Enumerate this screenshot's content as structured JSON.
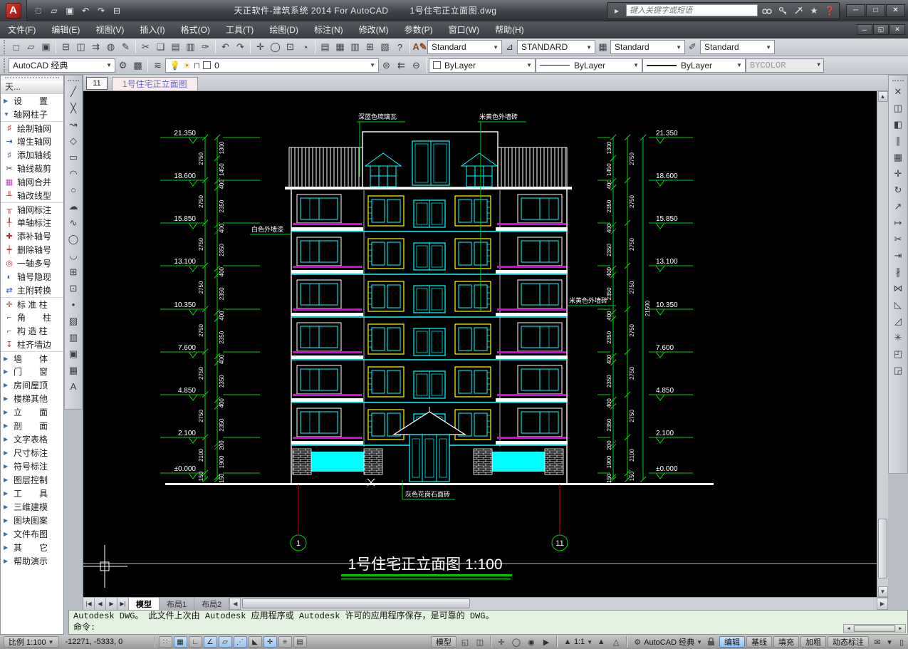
{
  "titlebar": {
    "app_title": "天正软件-建筑系统 2014  For AutoCAD",
    "doc_title": "1号住宅正立面图.dwg",
    "search_placeholder": "键入关键字或短语"
  },
  "icons": {
    "star": "★",
    "help": "?",
    "gear": "⚙",
    "caret": "▾",
    "min": "─",
    "max": "□",
    "close": "✕",
    "restore": "◱"
  },
  "menus": [
    "文件(F)",
    "编辑(E)",
    "视图(V)",
    "插入(I)",
    "格式(O)",
    "工具(T)",
    "绘图(D)",
    "标注(N)",
    "修改(M)",
    "参数(P)",
    "窗口(W)",
    "帮助(H)"
  ],
  "qat_tools": [
    {
      "name": "new",
      "glyph": "□"
    },
    {
      "name": "open",
      "glyph": "▱"
    },
    {
      "name": "save",
      "glyph": "▣"
    },
    {
      "name": "undo",
      "glyph": "↶"
    },
    {
      "name": "redo",
      "glyph": "↷"
    },
    {
      "name": "plot",
      "glyph": "⊟"
    }
  ],
  "toolbar1_tools": [
    {
      "name": "new",
      "glyph": "□"
    },
    {
      "name": "open",
      "glyph": "▱"
    },
    {
      "name": "save",
      "glyph": "▣"
    },
    {
      "name": "print",
      "glyph": "⊟"
    },
    {
      "name": "plot-preview",
      "glyph": "◫"
    },
    {
      "name": "publish",
      "glyph": "⇉"
    },
    {
      "name": "web",
      "glyph": "◍"
    },
    {
      "name": "markup",
      "glyph": "✎"
    },
    {
      "name": "cut",
      "glyph": "✂"
    },
    {
      "name": "copy-clip",
      "glyph": "❏"
    },
    {
      "name": "paste",
      "glyph": "▤"
    },
    {
      "name": "paste-block",
      "glyph": "▥"
    },
    {
      "name": "match-properties",
      "glyph": "✑"
    },
    {
      "name": "undo",
      "glyph": "↶"
    },
    {
      "name": "redo",
      "glyph": "↷"
    },
    {
      "name": "pan",
      "glyph": "✛"
    },
    {
      "name": "zoom-realtime",
      "glyph": "◯"
    },
    {
      "name": "zoom-window",
      "glyph": "⊡"
    },
    {
      "name": "zoom-previous",
      "glyph": "◔"
    },
    {
      "name": "properties",
      "glyph": "▤"
    },
    {
      "name": "designcenter",
      "glyph": "▦"
    },
    {
      "name": "tool-palettes",
      "glyph": "▥"
    },
    {
      "name": "sheet-set",
      "glyph": "⊞"
    },
    {
      "name": "calculator",
      "glyph": "▧"
    },
    {
      "name": "help",
      "glyph": "?"
    }
  ],
  "toolbar": {
    "text_style": "Standard",
    "dim_style": "STANDARD",
    "table_style": "Standard",
    "mleader_style": "Standard",
    "workspace": "AutoCAD 经典",
    "layer_value": "0",
    "color": "ByLayer",
    "linetype": "ByLayer",
    "lineweight": "ByLayer",
    "plot_style": "BYCOLOR"
  },
  "palette": {
    "title": "天...",
    "items": [
      {
        "t": "group",
        "label": "设　　置",
        "arrow": "▶"
      },
      {
        "t": "group",
        "label": "轴网柱子",
        "arrow": "▼"
      },
      {
        "t": "cmd",
        "label": "绘制轴网",
        "icon": "♯",
        "c": "#c03030",
        "sep": true
      },
      {
        "t": "cmd",
        "label": "增生轴网",
        "icon": "⇥",
        "c": "#3355bb"
      },
      {
        "t": "cmd",
        "label": "添加轴线",
        "icon": "♯",
        "c": "#667788"
      },
      {
        "t": "cmd",
        "label": "轴线裁剪",
        "icon": "✂",
        "c": "#333333"
      },
      {
        "t": "cmd",
        "label": "轴网合并",
        "icon": "▦",
        "c": "#bb44bb"
      },
      {
        "t": "cmd",
        "label": "轴改线型",
        "icon": "╨",
        "c": "#c03030"
      },
      {
        "t": "cmd",
        "label": "轴网标注",
        "icon": "╥",
        "c": "#c03030",
        "sep": true
      },
      {
        "t": "cmd",
        "label": "单轴标注",
        "icon": "╀",
        "c": "#c03030"
      },
      {
        "t": "cmd",
        "label": "添补轴号",
        "icon": "✚",
        "c": "#c03030"
      },
      {
        "t": "cmd",
        "label": "删除轴号",
        "icon": "┿",
        "c": "#c03030"
      },
      {
        "t": "cmd",
        "label": "一轴多号",
        "icon": "◎",
        "c": "#c03030"
      },
      {
        "t": "cmd",
        "label": "轴号隐现",
        "icon": "◐",
        "c": "#3355bb"
      },
      {
        "t": "cmd",
        "label": "主附转换",
        "icon": "⇄",
        "c": "#3355bb"
      },
      {
        "t": "cmd",
        "label": "标 准 柱",
        "icon": "✛",
        "c": "#c03030",
        "sep": true
      },
      {
        "t": "cmd",
        "label": "角　　柱",
        "icon": "⌐",
        "c": "#3355bb"
      },
      {
        "t": "cmd",
        "label": "构 造 柱",
        "icon": "⌐",
        "c": "#555555"
      },
      {
        "t": "cmd",
        "label": "柱齐墙边",
        "icon": "↧",
        "c": "#c03030"
      },
      {
        "t": "group",
        "label": "墙　　体",
        "arrow": "▶",
        "sep": true
      },
      {
        "t": "group",
        "label": "门　　窗",
        "arrow": "▶"
      },
      {
        "t": "group",
        "label": "房间屋顶",
        "arrow": "▶"
      },
      {
        "t": "group",
        "label": "楼梯其他",
        "arrow": "▶"
      },
      {
        "t": "group",
        "label": "立　　面",
        "arrow": "▶"
      },
      {
        "t": "group",
        "label": "剖　　面",
        "arrow": "▶"
      },
      {
        "t": "group",
        "label": "文字表格",
        "arrow": "▶"
      },
      {
        "t": "group",
        "label": "尺寸标注",
        "arrow": "▶"
      },
      {
        "t": "group",
        "label": "符号标注",
        "arrow": "▶"
      },
      {
        "t": "group",
        "label": "图层控制",
        "arrow": "▶"
      },
      {
        "t": "group",
        "label": "工　　具",
        "arrow": "▶"
      },
      {
        "t": "group",
        "label": "三维建模",
        "arrow": "▶"
      },
      {
        "t": "group",
        "label": "图块图案",
        "arrow": "▶"
      },
      {
        "t": "group",
        "label": "文件布图",
        "arrow": "▶"
      },
      {
        "t": "group",
        "label": "其　　它",
        "arrow": "▶"
      },
      {
        "t": "group",
        "label": "帮助演示",
        "arrow": "▶"
      }
    ]
  },
  "draw_tools": [
    {
      "name": "line",
      "glyph": "╱"
    },
    {
      "name": "construction-line",
      "glyph": "╳"
    },
    {
      "name": "polyline",
      "glyph": "↝"
    },
    {
      "name": "polygon",
      "glyph": "◇"
    },
    {
      "name": "rectangle",
      "glyph": "▭"
    },
    {
      "name": "arc",
      "glyph": "◠"
    },
    {
      "name": "circle",
      "glyph": "○"
    },
    {
      "name": "revision-cloud",
      "glyph": "☁"
    },
    {
      "name": "spline",
      "glyph": "∿"
    },
    {
      "name": "ellipse",
      "glyph": "◯"
    },
    {
      "name": "ellipse-arc",
      "glyph": "◡"
    },
    {
      "name": "insert-block",
      "glyph": "⊞"
    },
    {
      "name": "make-block",
      "glyph": "⊡"
    },
    {
      "name": "point",
      "glyph": "•"
    },
    {
      "name": "hatch",
      "glyph": "▨"
    },
    {
      "name": "gradient",
      "glyph": "▥"
    },
    {
      "name": "region",
      "glyph": "▣"
    },
    {
      "name": "table",
      "glyph": "▦"
    },
    {
      "name": "text",
      "glyph": "A"
    }
  ],
  "modify_tools": [
    {
      "name": "erase",
      "glyph": "✕"
    },
    {
      "name": "copy",
      "glyph": "◫"
    },
    {
      "name": "mirror",
      "glyph": "◧"
    },
    {
      "name": "offset",
      "glyph": "∥"
    },
    {
      "name": "array",
      "glyph": "▦"
    },
    {
      "name": "move",
      "glyph": "✛"
    },
    {
      "name": "rotate",
      "glyph": "↻"
    },
    {
      "name": "scale",
      "glyph": "↗"
    },
    {
      "name": "stretch",
      "glyph": "↦"
    },
    {
      "name": "trim",
      "glyph": "✂"
    },
    {
      "name": "extend",
      "glyph": "⇥"
    },
    {
      "name": "break",
      "glyph": "∦"
    },
    {
      "name": "join",
      "glyph": "⋈"
    },
    {
      "name": "chamfer",
      "glyph": "◺"
    },
    {
      "name": "fillet",
      "glyph": "◿"
    },
    {
      "name": "explode",
      "glyph": "✳"
    },
    {
      "name": "draworder-front",
      "glyph": "◰"
    },
    {
      "name": "draworder-back",
      "glyph": "◲"
    }
  ],
  "doc_tab": {
    "view_number": "11",
    "name": "1号住宅正立面图"
  },
  "layout_tabs": [
    {
      "label": "模型",
      "active": true
    },
    {
      "label": "布局1",
      "active": false
    },
    {
      "label": "布局2",
      "active": false
    }
  ],
  "drawing": {
    "title": "1号住宅正立面图  1:100",
    "levels": [
      "21.350",
      "18.600",
      "15.850",
      "13.100",
      "10.350",
      "7.600",
      "4.850",
      "2.100",
      "±0.000"
    ],
    "floor_dims": [
      "2750",
      "2750",
      "2750",
      "2750",
      "2750",
      "2750",
      "2750",
      "2100",
      "150"
    ],
    "detail_dims": [
      "1300",
      "1450",
      "400",
      "2350",
      "400",
      "2350",
      "400",
      "2350",
      "400",
      "2350",
      "400",
      "2350",
      "400",
      "2350",
      "200",
      "1900",
      "150"
    ],
    "total_dim": "21500",
    "annotations": {
      "roof": "深蓝色琉璃瓦",
      "wall_upper": "米黄色外墙砖",
      "wall_left": "白色外墙漆",
      "wall_right": "米黄色外墙砖",
      "base": "灰色花岗石面砖"
    },
    "axis_left": "1",
    "axis_right": "11"
  },
  "command": {
    "history": "Autodesk DWG。  此文件上次由 Autodesk 应用程序或 Autodesk 许可的应用程序保存，是可靠的 DWG。",
    "prompt": "命令:"
  },
  "statusbar": {
    "scale": "比例 1:100",
    "coords": "-12271, -5333, 0",
    "toggles": [
      {
        "name": "snap",
        "glyph": "∷",
        "on": false
      },
      {
        "name": "grid",
        "glyph": "▦",
        "on": true
      },
      {
        "name": "ortho",
        "glyph": "∟",
        "on": false
      },
      {
        "name": "polar",
        "glyph": "∠",
        "on": true
      },
      {
        "name": "osnap",
        "glyph": "▱",
        "on": true
      },
      {
        "name": "otrack",
        "glyph": "⋰",
        "on": true
      },
      {
        "name": "ducs",
        "glyph": "◣",
        "on": false
      },
      {
        "name": "dyn",
        "glyph": "✛",
        "on": true
      },
      {
        "name": "lwt",
        "glyph": "≡",
        "on": false
      },
      {
        "name": "qp",
        "glyph": "▤",
        "on": false
      }
    ],
    "model": "模型",
    "annot_scale": "1:1",
    "workspace": "AutoCAD 经典",
    "buttons": [
      {
        "label": "编辑",
        "active": true
      },
      {
        "label": "基线",
        "active": false
      },
      {
        "label": "填充",
        "active": false
      },
      {
        "label": "加粗",
        "active": false
      },
      {
        "label": "动态标注",
        "active": false
      }
    ]
  }
}
